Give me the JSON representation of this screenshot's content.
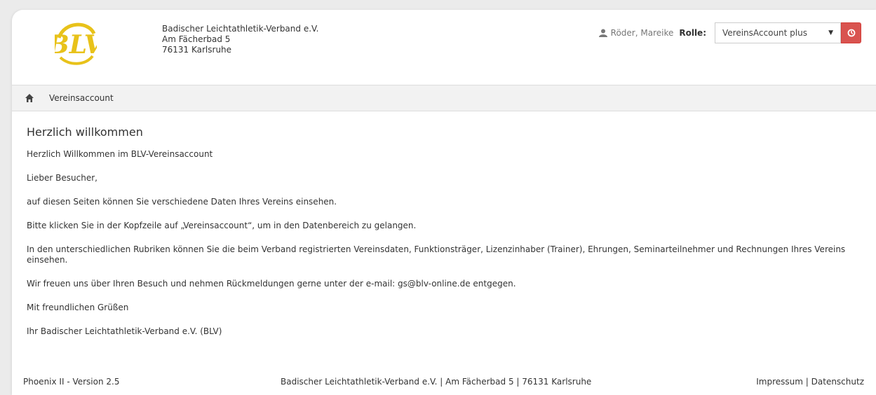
{
  "header": {
    "logo_text": "BLV",
    "address": {
      "line1": "Badischer Leichtathletik-Verband e.V.",
      "line2": "Am Fächerbad 5",
      "line3": "76131 Karlsruhe"
    },
    "user": {
      "icon": "user-icon",
      "name": "Röder, Mareike",
      "role_label": "Rolle:",
      "role_value": "VereinsAccount plus",
      "logout_icon": "power-icon"
    }
  },
  "nav": {
    "home_icon": "home-icon",
    "items": [
      {
        "label": "Vereinsaccount"
      }
    ]
  },
  "content": {
    "title": "Herzlich willkommen",
    "paragraphs": [
      "Herzlich Willkommen im BLV-Vereinsaccount",
      "Lieber Besucher,",
      "auf diesen Seiten können Sie verschiedene Daten Ihres Vereins einsehen.",
      "Bitte klicken Sie in der Kopfzeile auf „Vereinsaccount“, um in den Datenbereich zu gelangen.",
      "In den unterschiedlichen Rubriken können Sie die beim Verband registrierten Vereinsdaten, Funktionsträger, Lizenzinhaber (Trainer), Ehrungen, Seminarteilnehmer und Rechnungen Ihres Vereins einsehen.",
      "Wir freuen uns über Ihren Besuch und nehmen Rückmeldungen gerne unter der e-mail: gs@blv-online.de entgegen.",
      "Mit freundlichen Grüßen",
      "Ihr Badischer Leichtathletik-Verband e.V. (BLV)"
    ]
  },
  "footer": {
    "version": "Phoenix II - Version 2.5",
    "address": "Badischer Leichtathletik-Verband e.V. | Am Fächerbad 5 | 76131 Karlsruhe",
    "impressum": "Impressum",
    "separator": "|",
    "datenschutz": "Datenschutz"
  },
  "colors": {
    "logo": "#e8c21a",
    "logout": "#d9534f",
    "navbar": "#f2f2f2"
  }
}
